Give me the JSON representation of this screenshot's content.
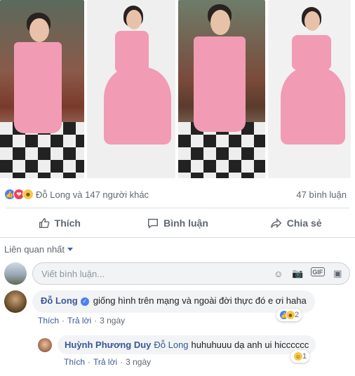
{
  "reactions": {
    "icons": [
      "like-reaction-icon",
      "love-reaction-icon",
      "haha-reaction-icon"
    ],
    "summary": "Đỗ Long và 147 người khác",
    "comments_count": "47 bình luận"
  },
  "actions": {
    "like": "Thích",
    "comment": "Bình luận",
    "share": "Chia sẻ"
  },
  "sort": {
    "label": "Liên quan nhất"
  },
  "composer": {
    "placeholder": "Viết bình luận..."
  },
  "comments": [
    {
      "author": "Đỗ Long",
      "verified": true,
      "text": "giống hình trên mạng và ngoài đời thực đó e ơi haha",
      "like_label": "Thích",
      "reply_label": "Trả lời",
      "time": "3 ngày",
      "reaction_count": "2"
    },
    {
      "author": "Huỳnh Phương Duy",
      "mention": "Đỗ Long",
      "text": "huhuhuuu dạ anh ui hicccccc",
      "like_label": "Thích",
      "reply_label": "Trả lời",
      "time": "3 ngày",
      "reaction_count": "1"
    }
  ],
  "colors": {
    "link": "#385898",
    "muted": "#606770",
    "like_blue": "#4a80f5",
    "bubble": "#f2f3f5"
  }
}
